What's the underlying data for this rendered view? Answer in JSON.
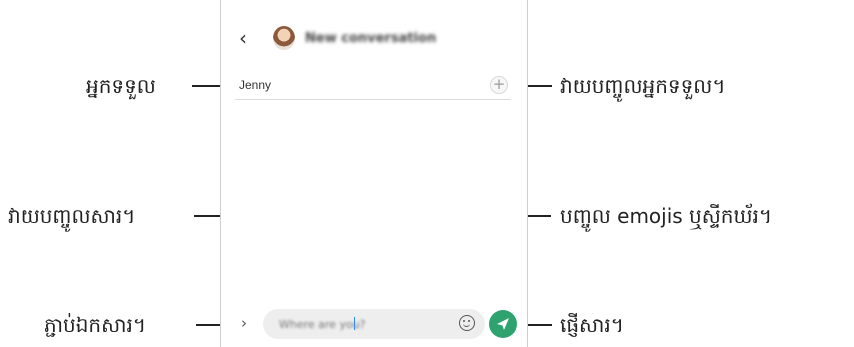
{
  "header": {
    "back_glyph": "‹",
    "title": "New conversation"
  },
  "recipient": {
    "value": "Jenny",
    "add_glyph": "+"
  },
  "composer": {
    "attach_glyph": "›",
    "placeholder": "Where are you?"
  },
  "callouts": {
    "recipient": "អ្នកទទួល",
    "enter_recipient": "វាយបញ្ចូលអ្នកទទួល។",
    "enter_message": "វាយបញ្ចូលសារ។",
    "insert_emoji": "បញ្ចូល emojis ឬស្ទីកឃ័រ។",
    "attach_file": "ភ្ជាប់ឯកសារ។",
    "send_message": "ផ្ញើសារ។"
  },
  "colors": {
    "send_button": "#2ea36f",
    "caret": "#2f8cff"
  }
}
